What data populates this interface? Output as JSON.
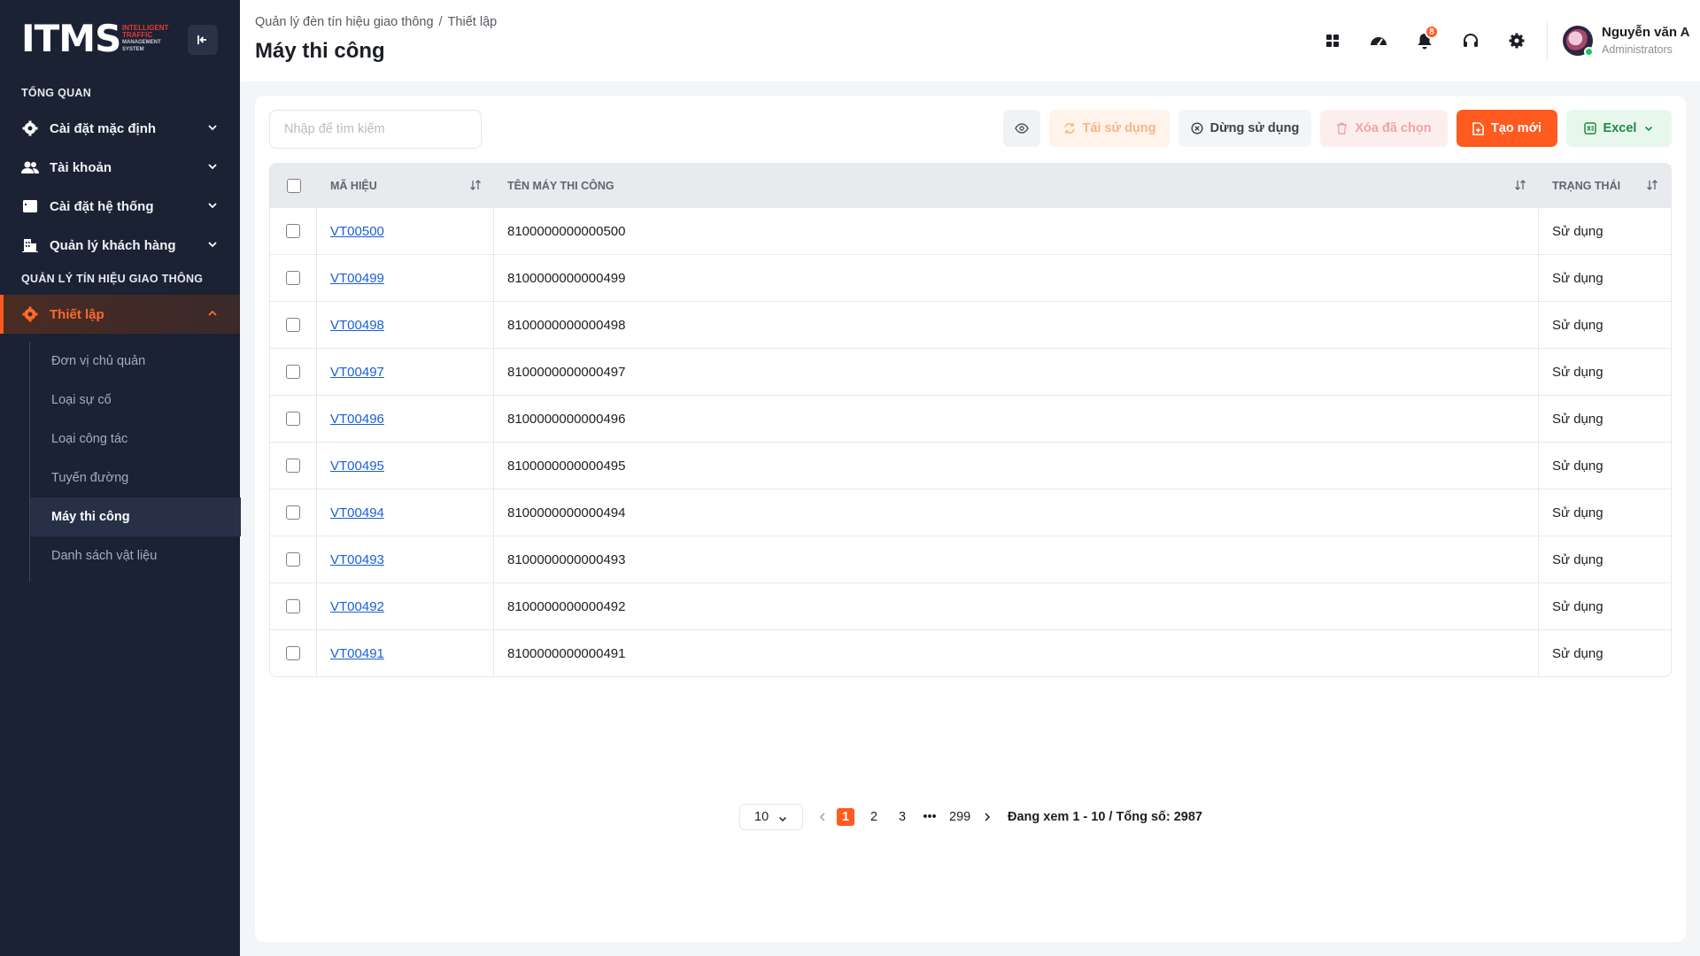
{
  "brand": {
    "logo_text": "ITMS",
    "logo_sub1": "INTELLIGENT",
    "logo_sub2": "TRAFFIC",
    "logo_sub3": "MANAGEMENT SYSTEM"
  },
  "sidebar": {
    "section_overview": "TỔNG QUAN",
    "items": [
      {
        "label": "Cài đặt mặc định",
        "icon": "gear-icon"
      },
      {
        "label": "Tài khoản",
        "icon": "users-icon"
      },
      {
        "label": "Cài đặt hệ thống",
        "icon": "window-icon"
      },
      {
        "label": "Quản lý khách hàng",
        "icon": "building-icon"
      }
    ],
    "section_traffic": "QUẢN LÝ TÍN HIỆU GIAO THÔNG",
    "active_item": {
      "label": "Thiết lập",
      "icon": "gear-icon"
    },
    "sub_items": [
      {
        "label": "Đơn vị chủ quản"
      },
      {
        "label": "Loại sự cố"
      },
      {
        "label": "Loại công tác"
      },
      {
        "label": "Tuyến đường"
      },
      {
        "label": "Máy thi công"
      },
      {
        "label": "Danh sách vật liệu"
      }
    ]
  },
  "header": {
    "breadcrumb": [
      "Quản lý đèn tín hiệu giao thông",
      "Thiết lập"
    ],
    "breadcrumb_sep": "/",
    "title": "Máy thi công",
    "notification_count": "8",
    "user_name": "Nguyễn văn A",
    "user_role": "Administrators"
  },
  "toolbar": {
    "search_placeholder": "Nhập để tìm kiếm",
    "reuse_label": "Tái sử dụng",
    "stop_label": "Dừng sử dụng",
    "delete_label": "Xóa đã chọn",
    "create_label": "Tạo mới",
    "excel_label": "Excel"
  },
  "table": {
    "columns": [
      "MÃ HIỆU",
      "TÊN MÁY THI CÔNG",
      "TRẠNG THÁI"
    ],
    "rows": [
      {
        "code": "VT00500",
        "name": "8100000000000500",
        "status": "Sử dụng"
      },
      {
        "code": "VT00499",
        "name": "8100000000000499",
        "status": "Sử dụng"
      },
      {
        "code": "VT00498",
        "name": "8100000000000498",
        "status": "Sử dụng"
      },
      {
        "code": "VT00497",
        "name": "8100000000000497",
        "status": "Sử dụng"
      },
      {
        "code": "VT00496",
        "name": "8100000000000496",
        "status": "Sử dụng"
      },
      {
        "code": "VT00495",
        "name": "8100000000000495",
        "status": "Sử dụng"
      },
      {
        "code": "VT00494",
        "name": "8100000000000494",
        "status": "Sử dụng"
      },
      {
        "code": "VT00493",
        "name": "8100000000000493",
        "status": "Sử dụng"
      },
      {
        "code": "VT00492",
        "name": "8100000000000492",
        "status": "Sử dụng"
      },
      {
        "code": "VT00491",
        "name": "8100000000000491",
        "status": "Sử dụng"
      }
    ]
  },
  "pagination": {
    "page_size": "10",
    "pages": [
      "1",
      "2",
      "3",
      "•••",
      "299"
    ],
    "current": "1",
    "info": "Đang xem 1 - 10 / Tổng số: 2987"
  },
  "colors": {
    "accent": "#ff5a1f",
    "sidebar_bg": "#1b2233",
    "link": "#1a5fd6",
    "excel_green": "#1f8a46"
  }
}
